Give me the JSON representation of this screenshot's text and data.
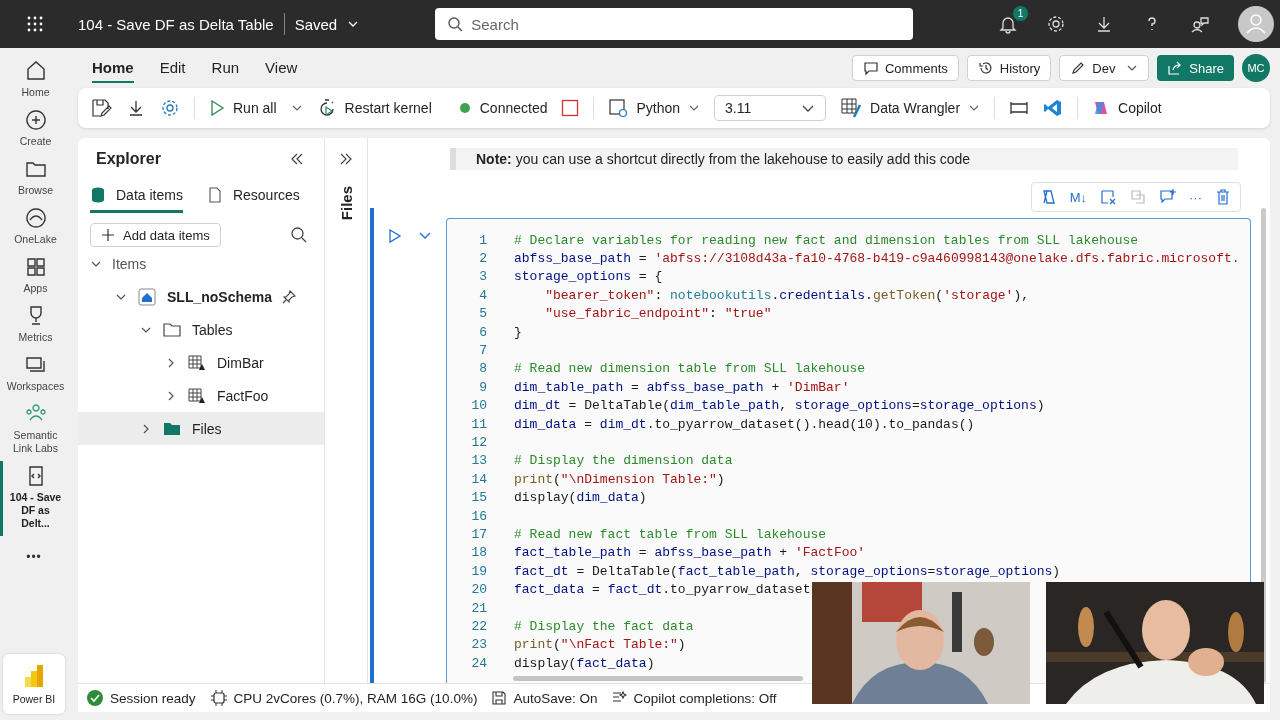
{
  "header": {
    "title": "104 - Save DF as Delta Table",
    "save_state": "Saved",
    "search": {
      "placeholder": "Search"
    },
    "notification_count": "1"
  },
  "rail": [
    {
      "label": "Home",
      "selected": false
    },
    {
      "label": "Create",
      "selected": false
    },
    {
      "label": "Browse",
      "selected": false
    },
    {
      "label": "OneLake",
      "selected": false
    },
    {
      "label": "Apps",
      "selected": false
    },
    {
      "label": "Metrics",
      "selected": false
    },
    {
      "label": "Workspaces",
      "selected": false
    },
    {
      "label": "Semantic Link Labs",
      "selected": false
    },
    {
      "label": "104 - Save DF as Delt...",
      "selected": true
    }
  ],
  "rail_more": "•••",
  "rail_app": "Power BI",
  "ribbon_tabs": [
    {
      "label": "Home",
      "selected": true
    },
    {
      "label": "Edit",
      "selected": false
    },
    {
      "label": "Run",
      "selected": false
    },
    {
      "label": "View",
      "selected": false
    }
  ],
  "ribbon_buttons": {
    "comments": "Comments",
    "history": "History",
    "develop": "Dev",
    "share": "Share",
    "user_initials": "MC"
  },
  "toolbar": {
    "run_all": "Run all",
    "restart": "Restart kernel",
    "connection": {
      "label": "Connected",
      "color": "#3fa34d"
    },
    "language": "Python",
    "version": "3.11",
    "wrangler": "Data Wrangler",
    "copilot": "Copilot"
  },
  "explorer": {
    "title": "Explorer",
    "tabs": [
      {
        "label": "Data items",
        "selected": true
      },
      {
        "label": "Resources",
        "selected": false
      }
    ],
    "add_button": "Add data items",
    "tree": [
      {
        "label": "Items",
        "kind": "group",
        "expanded": true,
        "selected": false,
        "children": [
          {
            "label": "SLL_noSchema",
            "kind": "lakehouse",
            "expanded": true,
            "selected": false,
            "pinned": true,
            "children": [
              {
                "label": "Tables",
                "kind": "folder",
                "expanded": true,
                "selected": false,
                "children": [
                  {
                    "label": "DimBar",
                    "kind": "table",
                    "expanded": false,
                    "selected": false
                  },
                  {
                    "label": "FactFoo",
                    "kind": "table",
                    "expanded": false,
                    "selected": false
                  }
                ]
              },
              {
                "label": "Files",
                "kind": "files",
                "expanded": false,
                "selected": true
              }
            ]
          }
        ]
      }
    ]
  },
  "side_strip": {
    "label": "Files"
  },
  "notebook": {
    "note": "**Note:** you can use a shortcut directly from the lakehouse to easily add this code",
    "cell_toolbar": {
      "markdown": "M↓",
      "more": "···"
    },
    "code": [
      {
        "number": "1",
        "tokens": [
          {
            "kind": "comment",
            "text": "# Declare variables for reading new fact and dimension tables from SLL lakehouse"
          }
        ]
      },
      {
        "number": "2",
        "tokens": [
          {
            "kind": "name",
            "text": "abfss_base_path"
          },
          {
            "kind": "plain",
            "text": " = "
          },
          {
            "kind": "string",
            "text": "'abfss://3108d43a-fa10-4768-b419-c9a460998143@onelake.dfs.fabric.microsoft."
          }
        ]
      },
      {
        "number": "3",
        "tokens": [
          {
            "kind": "name",
            "text": "storage_options"
          },
          {
            "kind": "plain",
            "text": " = {"
          }
        ]
      },
      {
        "number": "4",
        "tokens": [
          {
            "kind": "string",
            "text": "    \"bearer_token\""
          },
          {
            "kind": "plain",
            "text": ": "
          },
          {
            "kind": "class",
            "text": "notebookutils"
          },
          {
            "kind": "plain",
            "text": "."
          },
          {
            "kind": "name",
            "text": "credentials"
          },
          {
            "kind": "plain",
            "text": "."
          },
          {
            "kind": "func",
            "text": "getToken"
          },
          {
            "kind": "plain",
            "text": "("
          },
          {
            "kind": "string",
            "text": "'storage'"
          },
          {
            "kind": "plain",
            "text": "),"
          }
        ]
      },
      {
        "number": "5",
        "tokens": [
          {
            "kind": "string",
            "text": "    \"use_fabric_endpoint\""
          },
          {
            "kind": "plain",
            "text": ": "
          },
          {
            "kind": "string",
            "text": "\"true\""
          }
        ]
      },
      {
        "number": "6",
        "tokens": [
          {
            "kind": "plain",
            "text": "}"
          }
        ]
      },
      {
        "number": "7"
      },
      {
        "number": "8",
        "tokens": [
          {
            "kind": "comment",
            "text": "# Read new dimension table from SLL lakehouse"
          }
        ]
      },
      {
        "number": "9",
        "tokens": [
          {
            "kind": "name",
            "text": "dim_table_path"
          },
          {
            "kind": "plain",
            "text": " = "
          },
          {
            "kind": "name",
            "text": "abfss_base_path"
          },
          {
            "kind": "plain",
            "text": " + "
          },
          {
            "kind": "string",
            "text": "'DimBar'"
          }
        ]
      },
      {
        "number": "10",
        "tokens": [
          {
            "kind": "name",
            "text": "dim_dt"
          },
          {
            "kind": "plain",
            "text": " = DeltaTable("
          },
          {
            "kind": "name",
            "text": "dim_table_path"
          },
          {
            "kind": "plain",
            "text": ", "
          },
          {
            "kind": "name",
            "text": "storage_options"
          },
          {
            "kind": "plain",
            "text": "="
          },
          {
            "kind": "name",
            "text": "storage_options"
          },
          {
            "kind": "plain",
            "text": ")"
          }
        ]
      },
      {
        "number": "11",
        "tokens": [
          {
            "kind": "name",
            "text": "dim_data"
          },
          {
            "kind": "plain",
            "text": " = "
          },
          {
            "kind": "name",
            "text": "dim_dt"
          },
          {
            "kind": "plain",
            "text": ".to_pyarrow_dataset().head(10).to_pandas()"
          }
        ]
      },
      {
        "number": "12"
      },
      {
        "number": "13",
        "tokens": [
          {
            "kind": "comment",
            "text": "# Display the dimension data"
          }
        ]
      },
      {
        "number": "14",
        "tokens": [
          {
            "kind": "func",
            "text": "print"
          },
          {
            "kind": "plain",
            "text": "("
          },
          {
            "kind": "string",
            "text": "\"\\nDimension Table:\""
          },
          {
            "kind": "plain",
            "text": ")"
          }
        ]
      },
      {
        "number": "15",
        "tokens": [
          {
            "kind": "plain",
            "text": "display("
          },
          {
            "kind": "name",
            "text": "dim_data"
          },
          {
            "kind": "plain",
            "text": ")"
          }
        ]
      },
      {
        "number": "16"
      },
      {
        "number": "17",
        "tokens": [
          {
            "kind": "comment",
            "text": "# Read new fact table from SLL lakehouse"
          }
        ]
      },
      {
        "number": "18",
        "tokens": [
          {
            "kind": "name",
            "text": "fact_table_path"
          },
          {
            "kind": "plain",
            "text": " = "
          },
          {
            "kind": "name",
            "text": "abfss_base_path"
          },
          {
            "kind": "plain",
            "text": " + "
          },
          {
            "kind": "string",
            "text": "'FactFoo'"
          }
        ]
      },
      {
        "number": "19",
        "tokens": [
          {
            "kind": "name",
            "text": "fact_dt"
          },
          {
            "kind": "plain",
            "text": " = DeltaTable("
          },
          {
            "kind": "name",
            "text": "fact_table_path"
          },
          {
            "kind": "plain",
            "text": ", "
          },
          {
            "kind": "name",
            "text": "storage_options"
          },
          {
            "kind": "plain",
            "text": "="
          },
          {
            "kind": "name",
            "text": "storage_options"
          },
          {
            "kind": "plain",
            "text": ")"
          }
        ]
      },
      {
        "number": "20",
        "tokens": [
          {
            "kind": "name",
            "text": "fact_data"
          },
          {
            "kind": "plain",
            "text": " = "
          },
          {
            "kind": "name",
            "text": "fact_dt"
          },
          {
            "kind": "plain",
            "text": ".to_pyarrow_dataset"
          }
        ]
      },
      {
        "number": "21"
      },
      {
        "number": "22",
        "tokens": [
          {
            "kind": "comment",
            "text": "# Display the fact data"
          }
        ]
      },
      {
        "number": "23",
        "tokens": [
          {
            "kind": "func",
            "text": "print"
          },
          {
            "kind": "plain",
            "text": "("
          },
          {
            "kind": "string",
            "text": "\"\\nFact Table:\""
          },
          {
            "kind": "plain",
            "text": ")"
          }
        ]
      },
      {
        "number": "24",
        "tokens": [
          {
            "kind": "plain",
            "text": "display("
          },
          {
            "kind": "name",
            "text": "fact_data"
          },
          {
            "kind": "plain",
            "text": ")"
          }
        ]
      }
    ]
  },
  "status_bar": {
    "session": "Session ready",
    "resources": "CPU 2vCores (0.7%), RAM 16G (10.0%)",
    "autosave": "AutoSave: On",
    "copilot": "Copilot completions: Off"
  }
}
